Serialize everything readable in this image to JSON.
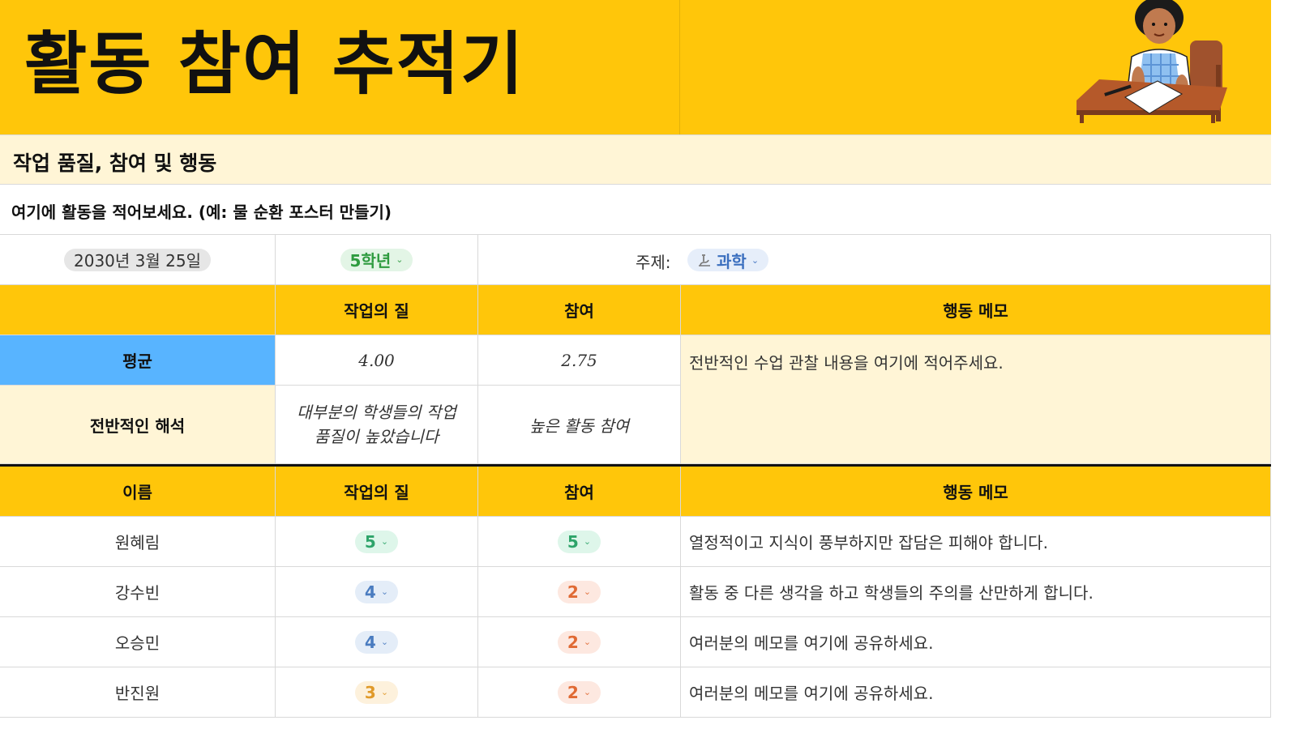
{
  "header": {
    "title": "활동 참여 추적기"
  },
  "subtitle": "작업 품질, 참여 및 행동",
  "activity": "여기에 활동을 적어보세요. (예: 물 순환 포스터 만들기)",
  "info": {
    "date": "2030년 3월 25일",
    "grade": "5학년",
    "subject_label": "주제:",
    "subject": "과학",
    "subject_icon": "microscope-icon"
  },
  "summary": {
    "headers": {
      "quality": "작업의 질",
      "engagement": "참여",
      "notes": "행동 메모"
    },
    "average_label": "평균",
    "average_quality": "4.00",
    "average_engagement": "2.75",
    "interpretation_label": "전반적인 해석",
    "interpretation_quality": "대부분의 학생들의 작업 품질이 높았습니다",
    "interpretation_engagement": "높은 활동 참여",
    "overall_note": "전반적인 수업 관찰 내용을 여기에 적어주세요."
  },
  "table": {
    "headers": {
      "name": "이름",
      "quality": "작업의 질",
      "engagement": "참여",
      "notes": "행동 메모"
    },
    "rows": [
      {
        "name": "원혜림",
        "quality": "5",
        "engagement": "5",
        "note": "열정적이고 지식이 풍부하지만 잡담은 피해야 합니다."
      },
      {
        "name": "강수빈",
        "quality": "4",
        "engagement": "2",
        "note": "활동 중 다른 생각을 하고 학생들의 주의를 산만하게 합니다."
      },
      {
        "name": "오승민",
        "quality": "4",
        "engagement": "2",
        "note": "여러분의 메모를 여기에 공유하세요."
      },
      {
        "name": "반진원",
        "quality": "3",
        "engagement": "2",
        "note": "여러분의 메모를 여기에 공유하세요."
      }
    ]
  },
  "colors": {
    "accent_yellow": "#ffc60a",
    "cream": "#fff5d6",
    "average_blue": "#58b4ff"
  }
}
